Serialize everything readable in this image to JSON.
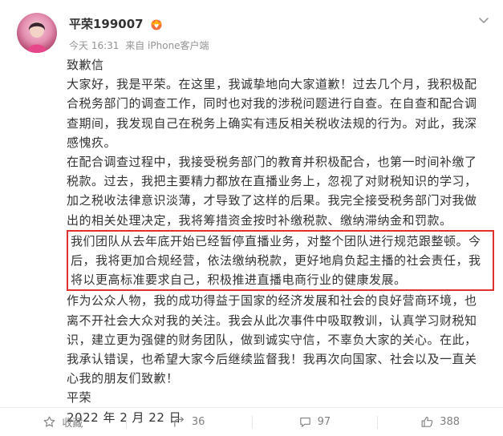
{
  "author": {
    "name": "平荣199007"
  },
  "meta": {
    "time": "今天 16:31",
    "source": "来自 iPhone客户端"
  },
  "post": {
    "title": "致歉信",
    "p1": "大家好，我是平荣。在这里，我诚挚地向大家道歉！过去几个月，我积极配合税务部门的调查工作，同时也对我的涉税问题进行自查。在自查和配合调查期间，我发现自己在税务上确实有违反相关税收法规的行为。对此，我深感愧疚。",
    "p2": "在配合调查过程中，我接受税务部门的教育并积极配合，也第一时间补缴了税款。过去，我把主要精力都放在直播业务上，忽视了对财税知识的学习，加之税收法律意识淡薄，才导致了这样的后果。我完全接受税务部门对我做出的相关处理决定，我将筹措资金按时补缴税款、缴纳滞纳金和罚款。",
    "p3_highlighted": "我们团队从去年底开始已经暂停直播业务，对整个团队进行规范跟整顿。今后，我将更加合规经营，依法缴纳税款，更好地肩负起主播的社会责任，我将以更高标准要求自己，积极推进直播电商行业的健康发展。",
    "p4": "作为公众人物，我的成功得益于国家的经济发展和社会的良好营商环境，也离不开社会大众对我的关注。我会从此次事件中吸取教训，认真学习财税知识，建立更为强健的财务团队，做到诚实守信，不辜负大家的关心。在此，我承认错误，也希望大家今后继续监督我！我再次向国家、社会以及一直关心我的朋友们致歉！",
    "signature": "平荣",
    "date": "2022 年 2 月 22 日"
  },
  "actions": {
    "favorite_label": "收藏",
    "repost_count": "36",
    "comment_count": "97",
    "like_count": "388"
  },
  "colors": {
    "highlight_border": "#e0312f",
    "text": "#333333",
    "meta": "#939393"
  },
  "icons": [
    "avatar",
    "vip-badge-icon",
    "chevron-down-icon",
    "star-icon",
    "repost-icon",
    "comment-icon",
    "like-icon"
  ]
}
